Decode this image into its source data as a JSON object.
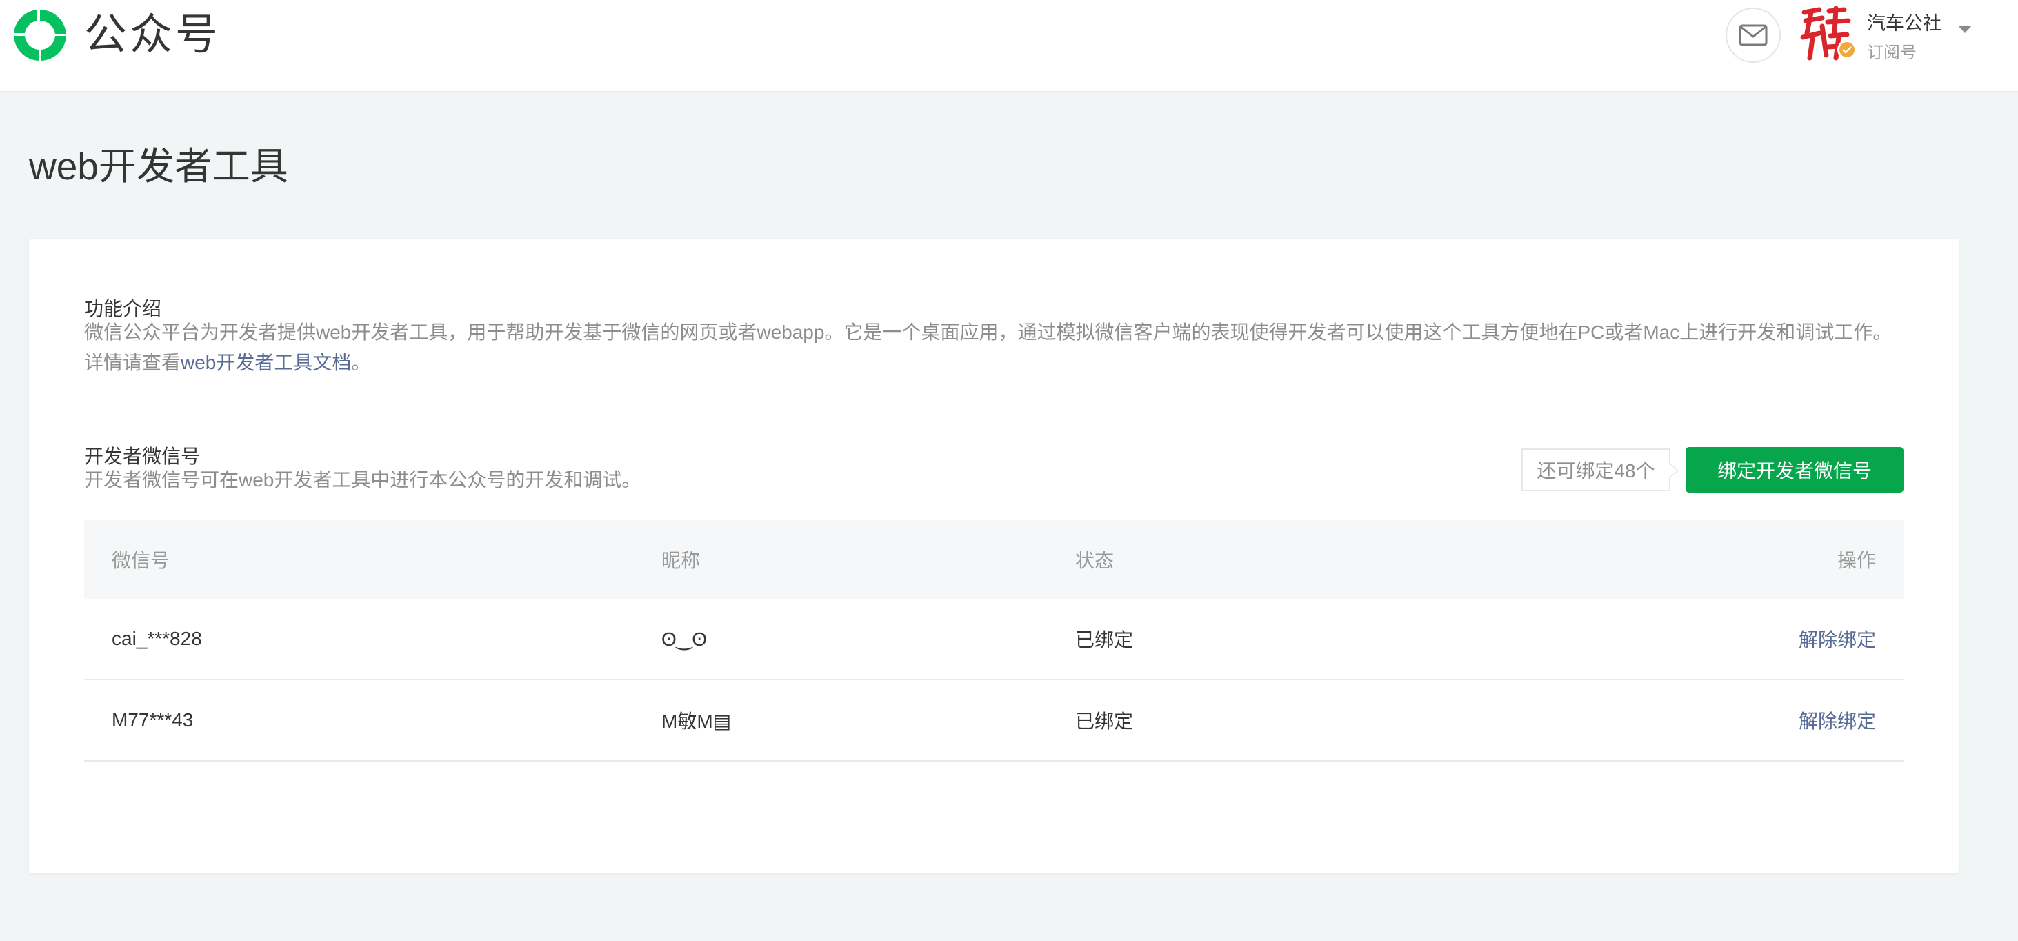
{
  "header": {
    "brand": "公众号",
    "account_name": "汽车公社",
    "account_type": "订阅号",
    "icons": {
      "logo": "wechat-mp-logo-icon",
      "mail": "mail-icon",
      "verified": "verified-check-icon",
      "dropdown": "caret-down-icon"
    }
  },
  "page": {
    "title": "web开发者工具"
  },
  "intro": {
    "title": "功能介绍",
    "desc": "微信公众平台为开发者提供web开发者工具，用于帮助开发基于微信的网页或者webapp。它是一个桌面应用，通过模拟微信客户端的表现使得开发者可以使用这个工具方便地在PC或者Mac上进行开发和调试工作。",
    "more_prefix": "详情请查看",
    "more_link": "web开发者工具文档",
    "more_suffix": "。"
  },
  "developers": {
    "title": "开发者微信号",
    "desc": "开发者微信号可在web开发者工具中进行本公众号的开发和调试。",
    "quota": "还可绑定48个",
    "bind_button": "绑定开发者微信号",
    "columns": [
      "微信号",
      "昵称",
      "状态",
      "操作"
    ],
    "rows": [
      {
        "wechat_id": "cai_***828",
        "nickname": "ʘ‿ʘ",
        "status": "已绑定",
        "action": "解除绑定"
      },
      {
        "wechat_id": "M77***43",
        "nickname": "M敏M▤",
        "status": "已绑定",
        "action": "解除绑定"
      }
    ]
  },
  "colors": {
    "primary_green": "#07a64c",
    "link_blue": "#576b95",
    "background": "#f2f5f6"
  }
}
